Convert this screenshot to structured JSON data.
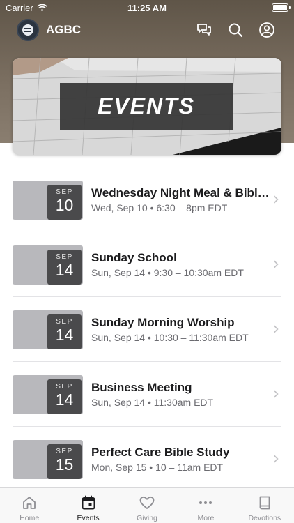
{
  "status_bar": {
    "carrier": "Carrier",
    "time": "11:25 AM"
  },
  "app_bar": {
    "title": "AGBC",
    "icons": [
      "chat-icon",
      "search-icon",
      "profile-icon"
    ]
  },
  "banner": {
    "title": "EVENTS"
  },
  "events": [
    {
      "month": "SEP",
      "day": "10",
      "title": "Wednesday Night Meal & Bible Study",
      "time": "Wed, Sep 10 • 6:30 – 8pm EDT"
    },
    {
      "month": "SEP",
      "day": "14",
      "title": "Sunday School",
      "time": "Sun, Sep 14 • 9:30 – 10:30am EDT"
    },
    {
      "month": "SEP",
      "day": "14",
      "title": "Sunday Morning Worship",
      "time": "Sun, Sep 14 • 10:30 – 11:30am EDT"
    },
    {
      "month": "SEP",
      "day": "14",
      "title": "Business Meeting",
      "time": "Sun, Sep 14 • 11:30am EDT"
    },
    {
      "month": "SEP",
      "day": "15",
      "title": "Perfect Care Bible Study",
      "time": "Mon, Sep 15 • 10 – 11am EDT"
    }
  ],
  "tabs": [
    {
      "label": "Home",
      "icon": "home-icon",
      "active": false
    },
    {
      "label": "Events",
      "icon": "calendar-icon",
      "active": true
    },
    {
      "label": "Giving",
      "icon": "heart-icon",
      "active": false
    },
    {
      "label": "More",
      "icon": "more-icon",
      "active": false
    },
    {
      "label": "Devotions",
      "icon": "book-icon",
      "active": false
    }
  ],
  "colors": {
    "header": "#7a6e60",
    "date_tile": "#b8b8bc",
    "date_box": "#4a4a4c",
    "tab_active": "#1c1c1e",
    "tab_inactive": "#8e8e93"
  }
}
